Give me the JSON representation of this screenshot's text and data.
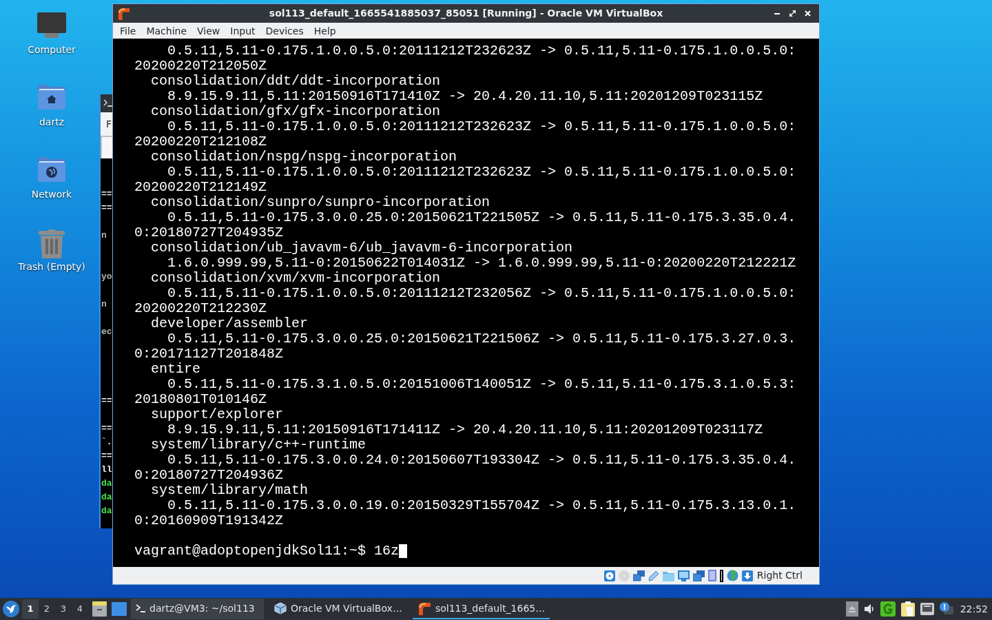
{
  "desktop_icons": [
    {
      "label": "Computer",
      "kind": "computer"
    },
    {
      "label": "dartz",
      "kind": "home"
    },
    {
      "label": "Network",
      "kind": "network"
    },
    {
      "label": "Trash (Empty)",
      "kind": "trash"
    }
  ],
  "background_window": {
    "menu_item": "F",
    "lines": [
      {
        "text": "==",
        "color": "#f0f0f0"
      },
      {
        "text": "==",
        "color": "#f0f0f0"
      },
      {
        "text": "n",
        "color": "#b4b4b4"
      },
      {
        "text": "yo",
        "color": "#b4b4b4"
      },
      {
        "text": "n",
        "color": "#b4b4b4"
      },
      {
        "text": "ec",
        "color": "#b4b4b4"
      },
      {
        "text": "==",
        "color": "#f0f0f0"
      },
      {
        "text": "==",
        "color": "#f0f0f0"
      },
      {
        "text": "`."
      },
      {
        "text": "==",
        "color": "#f0f0f0"
      },
      {
        "text": "ll",
        "color": "#f0f0f0"
      },
      {
        "text": "da",
        "color": "#4ee44e"
      },
      {
        "text": "da",
        "color": "#4ee44e"
      },
      {
        "text": "da",
        "color": "#4ee44e"
      }
    ]
  },
  "vm_window": {
    "title": "sol113_default_1665541885037_85051 [Running] - Oracle VM VirtualBox",
    "menu": [
      "File",
      "Machine",
      "View",
      "Input",
      "Devices",
      "Help"
    ],
    "terminal": {
      "lines": [
        {
          "kind": "version",
          "text": "0.5.11,5.11-0.175.1.0.0.5.0:20111212T232623Z -> 0.5.11,5.11-0.175.1.0.0.5.0:"
        },
        {
          "kind": "wrap",
          "text": "20200220T212050Z"
        },
        {
          "kind": "package",
          "text": "consolidation/ddt/ddt-incorporation"
        },
        {
          "kind": "version",
          "text": "8.9.15.9.11,5.11:20150916T171410Z -> 20.4.20.11.10,5.11:20201209T023115Z"
        },
        {
          "kind": "package",
          "text": "consolidation/gfx/gfx-incorporation"
        },
        {
          "kind": "version",
          "text": "0.5.11,5.11-0.175.1.0.0.5.0:20111212T232623Z -> 0.5.11,5.11-0.175.1.0.0.5.0:"
        },
        {
          "kind": "wrap",
          "text": "20200220T212108Z"
        },
        {
          "kind": "package",
          "text": "consolidation/nspg/nspg-incorporation"
        },
        {
          "kind": "version",
          "text": "0.5.11,5.11-0.175.1.0.0.5.0:20111212T232623Z -> 0.5.11,5.11-0.175.1.0.0.5.0:"
        },
        {
          "kind": "wrap",
          "text": "20200220T212149Z"
        },
        {
          "kind": "package",
          "text": "consolidation/sunpro/sunpro-incorporation"
        },
        {
          "kind": "version",
          "text": "0.5.11,5.11-0.175.3.0.0.25.0:20150621T221505Z -> 0.5.11,5.11-0.175.3.35.0.4."
        },
        {
          "kind": "wrap",
          "text": "0:20180727T204935Z"
        },
        {
          "kind": "package",
          "text": "consolidation/ub_javavm-6/ub_javavm-6-incorporation"
        },
        {
          "kind": "version",
          "text": "1.6.0.999.99,5.11-0:20150622T014031Z -> 1.6.0.999.99,5.11-0:20200220T212221Z"
        },
        {
          "kind": "package",
          "text": "consolidation/xvm/xvm-incorporation"
        },
        {
          "kind": "version",
          "text": "0.5.11,5.11-0.175.1.0.0.5.0:20111212T232056Z -> 0.5.11,5.11-0.175.1.0.0.5.0:"
        },
        {
          "kind": "wrap",
          "text": "20200220T212230Z"
        },
        {
          "kind": "package",
          "text": "developer/assembler"
        },
        {
          "kind": "version",
          "text": "0.5.11,5.11-0.175.3.0.0.25.0:20150621T221506Z -> 0.5.11,5.11-0.175.3.27.0.3."
        },
        {
          "kind": "wrap",
          "text": "0:20171127T201848Z"
        },
        {
          "kind": "package",
          "text": "entire"
        },
        {
          "kind": "version",
          "text": "0.5.11,5.11-0.175.3.1.0.5.0:20151006T140051Z -> 0.5.11,5.11-0.175.3.1.0.5.3:"
        },
        {
          "kind": "wrap",
          "text": "20180801T010146Z"
        },
        {
          "kind": "package",
          "text": "support/explorer"
        },
        {
          "kind": "version",
          "text": "8.9.15.9.11,5.11:20150916T171411Z -> 20.4.20.11.10,5.11:20201209T023117Z"
        },
        {
          "kind": "package",
          "text": "system/library/c++-runtime"
        },
        {
          "kind": "version",
          "text": "0.5.11,5.11-0.175.3.0.0.24.0:20150607T193304Z -> 0.5.11,5.11-0.175.3.35.0.4."
        },
        {
          "kind": "wrap",
          "text": "0:20180727T204936Z"
        },
        {
          "kind": "package",
          "text": "system/library/math"
        },
        {
          "kind": "version",
          "text": "0.5.11,5.11-0.175.3.0.0.19.0:20150329T155704Z -> 0.5.11,5.11-0.175.3.13.0.1."
        },
        {
          "kind": "wrap",
          "text": "0:20160909T191342Z"
        }
      ],
      "prompt": "vagrant@adoptopenjdkSol11:~$ 16z"
    },
    "status_bar": {
      "host_key": "Right Ctrl"
    }
  },
  "taskbar": {
    "workspaces": [
      {
        "label": "1",
        "selected": true
      },
      {
        "label": "2",
        "selected": false
      },
      {
        "label": "3",
        "selected": false
      },
      {
        "label": "4",
        "selected": false
      }
    ],
    "tasks": [
      {
        "kind": "terminal",
        "label": "dartz@VM3: ~/sol113",
        "selected": false,
        "highlighted": true
      },
      {
        "kind": "manager",
        "label": "Oracle VM VirtualBox…",
        "selected": false,
        "highlighted": false
      },
      {
        "kind": "vm",
        "label": "sol113_default_1665…",
        "selected": true,
        "highlighted": false
      }
    ],
    "clock": "22:52"
  }
}
